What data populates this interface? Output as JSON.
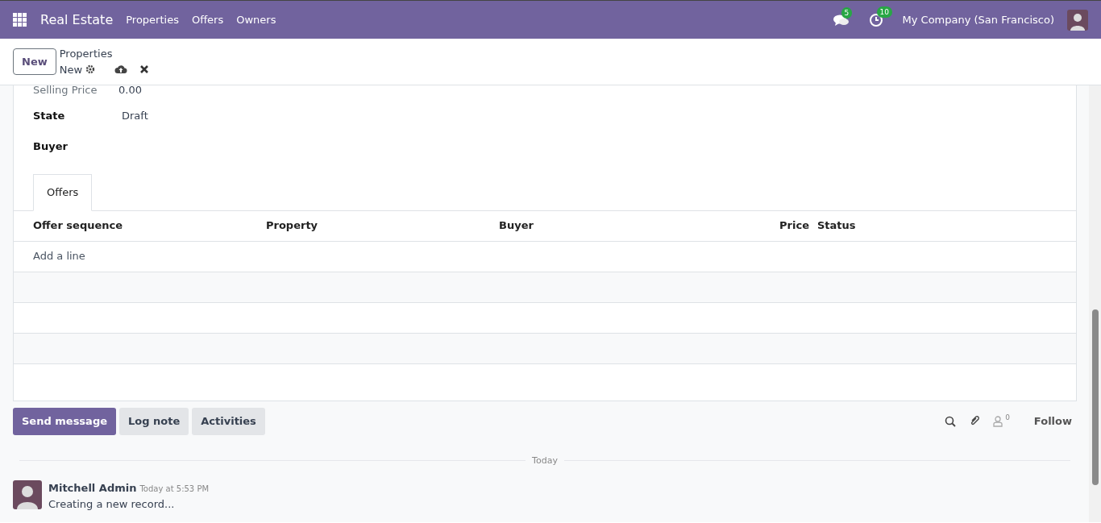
{
  "navbar": {
    "app_name": "Real Estate",
    "menu": [
      "Properties",
      "Offers",
      "Owners"
    ],
    "messages_count": "5",
    "activities_count": "10",
    "company": "My Company (San Francisco)"
  },
  "control_panel": {
    "new_button": "New",
    "breadcrumb": "Properties",
    "record_name": "New"
  },
  "form": {
    "fields": [
      {
        "label": "Selling Price",
        "value": "0.00",
        "bold": false
      },
      {
        "label": "State",
        "value": "Draft",
        "bold": true
      },
      {
        "label": "Buyer",
        "bold": true
      }
    ],
    "tabs": [
      {
        "label": "Offers",
        "selected": true
      }
    ],
    "offers_table": {
      "columns": [
        {
          "label": "Offer sequence",
          "kind": "text"
        },
        {
          "label": "Property",
          "kind": "text"
        },
        {
          "label": "Buyer",
          "kind": "text"
        },
        {
          "label": "Price",
          "kind": "number"
        },
        {
          "label": "Status",
          "kind": "text"
        }
      ],
      "add_line": "Add a line"
    }
  },
  "chatter": {
    "buttons": [
      {
        "label": "Send message",
        "primary": true
      },
      {
        "label": "Log note",
        "primary": false
      },
      {
        "label": "Activities",
        "primary": false
      }
    ],
    "followers_count": "0",
    "follow": "Follow",
    "date_separator": "Today",
    "messages": [
      {
        "author": "Mitchell Admin",
        "time": "Today at 5:53 PM",
        "body": "Creating a new record..."
      }
    ]
  }
}
